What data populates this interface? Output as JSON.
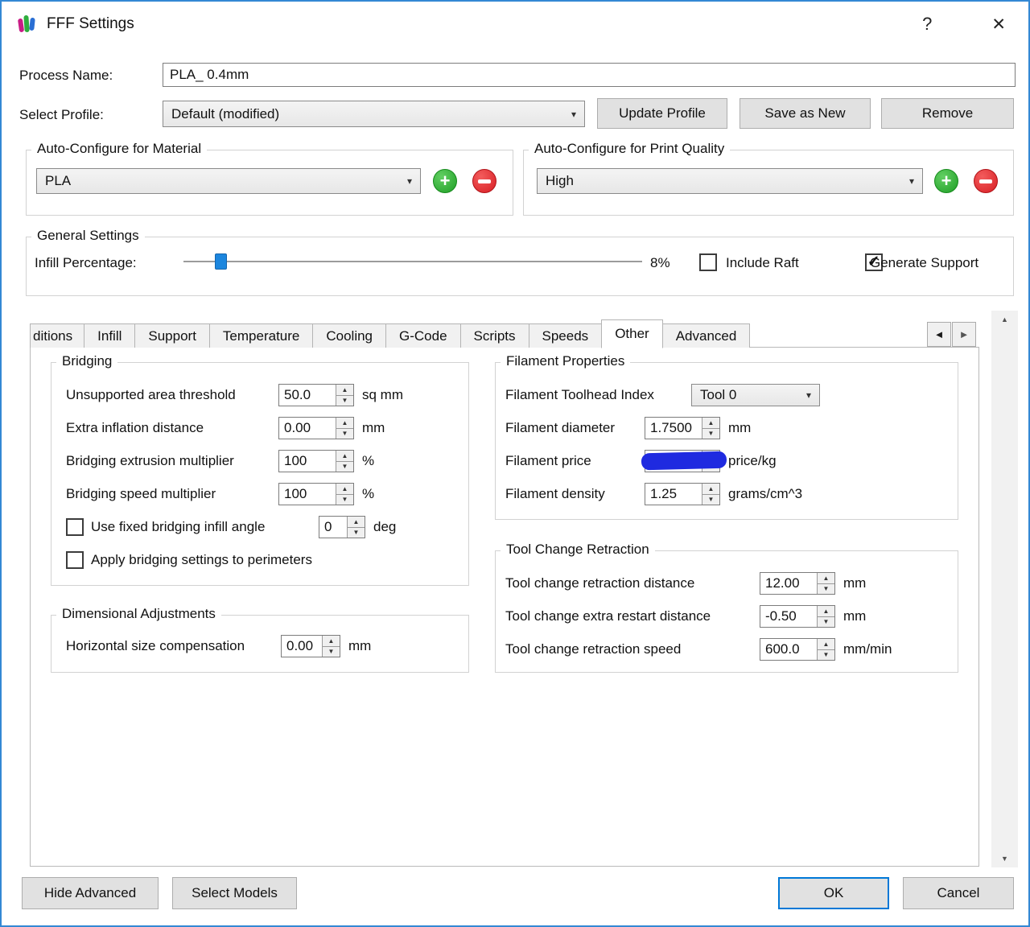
{
  "window": {
    "title": "FFF Settings",
    "help_label": "?",
    "close_label": "✕"
  },
  "header": {
    "process_name_label": "Process Name:",
    "process_name_value": "PLA_ 0.4mm",
    "select_profile_label": "Select Profile:",
    "select_profile_value": "Default (modified)",
    "update_profile_label": "Update Profile",
    "save_as_new_label": "Save as New",
    "remove_label": "Remove"
  },
  "auto_configure": {
    "material_title": "Auto-Configure for Material",
    "material_value": "PLA",
    "quality_title": "Auto-Configure for Print Quality",
    "quality_value": "High"
  },
  "general_settings": {
    "title": "General Settings",
    "infill_label": "Infill Percentage:",
    "infill_percent": 8,
    "infill_value": "8%",
    "include_raft_label": "Include Raft",
    "include_raft_checked": false,
    "generate_support_label": "Generate Support",
    "generate_support_checked": true
  },
  "tabs": {
    "active": "Other",
    "items": [
      {
        "label": "ditions"
      },
      {
        "label": "Infill"
      },
      {
        "label": "Support"
      },
      {
        "label": "Temperature"
      },
      {
        "label": "Cooling"
      },
      {
        "label": "G-Code"
      },
      {
        "label": "Scripts"
      },
      {
        "label": "Speeds"
      },
      {
        "label": "Other"
      },
      {
        "label": "Advanced"
      }
    ]
  },
  "bridging": {
    "title": "Bridging",
    "rows": [
      {
        "label": "Unsupported area threshold",
        "value": "50.0",
        "unit": "sq mm"
      },
      {
        "label": "Extra inflation distance",
        "value": "0.00",
        "unit": "mm"
      },
      {
        "label": "Bridging extrusion multiplier",
        "value": "100",
        "unit": "%"
      },
      {
        "label": "Bridging speed multiplier",
        "value": "100",
        "unit": "%"
      }
    ],
    "fixed_angle_label": "Use fixed bridging infill angle",
    "fixed_angle_checked": false,
    "fixed_angle_value": "0",
    "fixed_angle_unit": "deg",
    "apply_perimeters_label": "Apply bridging settings to perimeters",
    "apply_perimeters_checked": false
  },
  "dimensional": {
    "title": "Dimensional Adjustments",
    "row_label": "Horizontal size compensation",
    "row_value": "0.00",
    "row_unit": "mm"
  },
  "filament": {
    "title": "Filament Properties",
    "toolhead_label": "Filament Toolhead Index",
    "toolhead_value": "Tool 0",
    "rows": [
      {
        "label": "Filament diameter",
        "value": "1.7500",
        "unit": "mm"
      },
      {
        "label": "Filament price",
        "value": "",
        "unit": "price/kg",
        "redacted": true
      },
      {
        "label": "Filament density",
        "value": "1.25",
        "unit": "grams/cm^3"
      }
    ]
  },
  "tool_change": {
    "title": "Tool Change Retraction",
    "rows": [
      {
        "label": "Tool change retraction distance",
        "value": "12.00",
        "unit": "mm"
      },
      {
        "label": "Tool change extra restart distance",
        "value": "-0.50",
        "unit": "mm"
      },
      {
        "label": "Tool change retraction speed",
        "value": "600.0",
        "unit": "mm/min"
      }
    ]
  },
  "footer": {
    "hide_advanced_label": "Hide Advanced",
    "select_models_label": "Select Models",
    "ok_label": "OK",
    "cancel_label": "Cancel"
  },
  "colors": {
    "accent_blue": "#1c86de",
    "window_border": "#3388d4",
    "add_green": "#1f9e26",
    "remove_red": "#d81e24",
    "redaction_blue": "#1f2ae0"
  }
}
